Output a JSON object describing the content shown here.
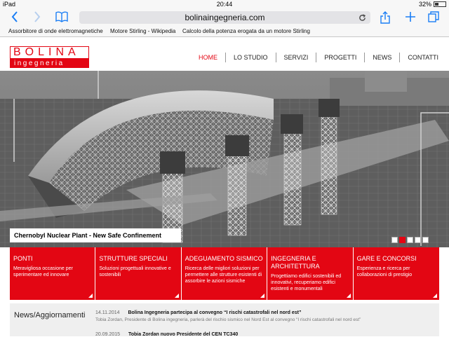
{
  "statusbar": {
    "device": "iPad",
    "time": "20:44",
    "battery": "32%"
  },
  "browser": {
    "url": "bolinaingegneria.com",
    "bookmarks": [
      "Assorbitore di onde elettromagnetiche",
      "Motore Stirling - Wikipedia",
      "Calcolo della potenza erogata da un motore Stirling"
    ],
    "icons": [
      "back-icon",
      "forward-icon",
      "bookmarks-icon",
      "reload-icon",
      "share-icon",
      "add-icon",
      "tabs-icon"
    ]
  },
  "site": {
    "logo_top": "BOLINA",
    "logo_bottom": "ingegneria",
    "nav": [
      "HOME",
      "LO STUDIO",
      "SERVIZI",
      "PROGETTI",
      "NEWS",
      "CONTATTI"
    ],
    "active_nav": "HOME",
    "hero_caption": "Chernobyl Nuclear Plant - New Safe Confinement",
    "slide_count": 5,
    "active_slide": 2,
    "features": [
      {
        "title": "PONTI",
        "desc": "Meravigliosa occasione per sperimentare ed innovare"
      },
      {
        "title": "STRUTTURE SPECIALI",
        "desc": "Soluzioni progettuali innovative e sostenibili"
      },
      {
        "title": "ADEGUAMENTO SISMICO",
        "desc": "Ricerca delle migliori soluzioni per permettere alle strutture esistenti di assorbire le azioni sismiche"
      },
      {
        "title": "INGEGNERIA E ARCHITETTURA",
        "desc": "Progettiamo edifici sostenibili ed innovativi, recuperiamo edifici esistenti e monumentali"
      },
      {
        "title": "GARE E CONCORSI",
        "desc": "Esperienza e ricerca per collaborazioni di prestigio"
      }
    ],
    "news_title": "News/Aggiornamenti",
    "news": [
      {
        "date": "14.11.2014",
        "headline": "Bolina Ingegneria partecipa al convegno “I rischi catastrofali nel nord est”",
        "sub": "Tobia Zordan, Presidente di Bolina ingegneria, parlerà del rischio sismico nel Nord Est al convegno “I rischi catastrofali nel nord est”"
      },
      {
        "date": "20.09.2015",
        "headline": "Tobia Zordan nuovo Presidente del CEN TC340",
        "sub": ""
      }
    ],
    "colors": {
      "brand_red": "#e30613",
      "ios_blue": "#1a7ef5"
    }
  }
}
